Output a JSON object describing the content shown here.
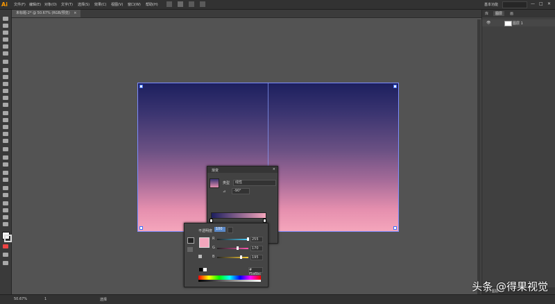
{
  "app": {
    "logo_text": "Ai"
  },
  "menubar": {
    "items": [
      {
        "label": "文件(F)"
      },
      {
        "label": "编辑(E)"
      },
      {
        "label": "对象(O)"
      },
      {
        "label": "文字(T)"
      },
      {
        "label": "选择(S)"
      },
      {
        "label": "效果(C)"
      },
      {
        "label": "视图(V)"
      },
      {
        "label": "窗口(W)"
      },
      {
        "label": "帮助(H)"
      }
    ],
    "workspace": "基本功能",
    "window_controls": [
      "—",
      "□",
      "✕"
    ]
  },
  "document": {
    "tab_label": "未标题-2* @ 50.67% (RGB/预览)",
    "tab_close": "×"
  },
  "right_panel": {
    "tabs": [
      "库",
      "图层",
      "画"
    ],
    "layer_name": "图层 1",
    "bottom_label": "1 个图层"
  },
  "gradient_panel": {
    "title": "渐变",
    "close": "×",
    "type_label": "类型",
    "type_value": "线性",
    "angle_value": "-90°"
  },
  "color_panel": {
    "opacity_label": "不透明度",
    "opacity_value": "100",
    "channels": [
      {
        "name": "R",
        "value": "255",
        "color": "#4ad1ff",
        "level": 0.98
      },
      {
        "name": "G",
        "value": "170",
        "color": "#ff57b0",
        "level": 0.66
      },
      {
        "name": "B",
        "value": "195",
        "color": "#ffd23a",
        "level": 0.76
      }
    ],
    "hex_value": "# f5a6bc",
    "swatch_color": "#f3a6bc"
  },
  "statusbar": {
    "zoom": "50.67%",
    "page": "1",
    "tool_name": "选择"
  },
  "watermark": "头条 @得果视觉"
}
